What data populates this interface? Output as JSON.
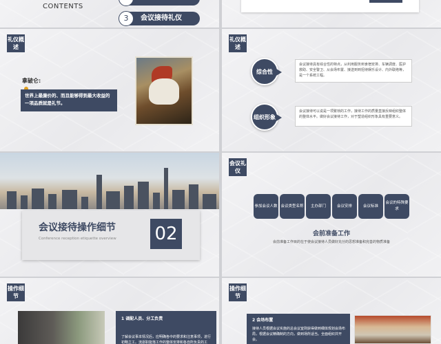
{
  "slide1": {
    "contents_label": "CONTENTS",
    "item3_number": "3",
    "item3_label": "会议接待礼仪"
  },
  "slide3": {
    "tag": "礼仪概述",
    "quote_author": "拿破仑:",
    "quote_text": "世界上最廉价的、而且能够得到最大收益的一项品质就是礼节。"
  },
  "slide4": {
    "tag": "礼仪概述",
    "bubble1": "综合性",
    "text1": "会议接待具有综合性的特点，从利用服务到食宿安排、车辆调度、医护救助、安全警卫、从会场布置、接送到到招待娱乐设计、内外联络等，是一个系统工程。",
    "bubble2": "组织形象",
    "text2": "会议接待可以说是一项繁琐的工作，接待工作的质量直接反映组织整体的整体水平。做好会议接待工作，对于塑造组织形象具有重要意义。"
  },
  "slide5": {
    "title": "会议接待操作细节",
    "subtitle": "Conference reception etiquette overview",
    "number": "02"
  },
  "slide6": {
    "tag": "会议礼仪",
    "items": [
      "参加会议人数",
      "会议类型名称",
      "主办部门",
      "会议安排",
      "会议标准",
      "会议的特殊要求"
    ],
    "prep_title": "会前准备工作",
    "prep_sub": "会前准备工作目的在于使会议接待人员做好充分的思想准备和完善的物质准备"
  },
  "slide7": {
    "tag": "操作细节",
    "step_title": "1  调配人员、分工负责",
    "step_text": "了解会议事本情况后，应明确各中的要求和注意事项，进行初略立工。流逐职能落工作的整体安排和各自所负责的工作。"
  },
  "slide8": {
    "tag": "操作细节",
    "step_title": "2  会场布置",
    "step_text": "接待人员根据会议实施的总会议室则获得做到细体规划会场布局，根据会议精确制的方向，做到场所适当。全面组织并开会。"
  }
}
